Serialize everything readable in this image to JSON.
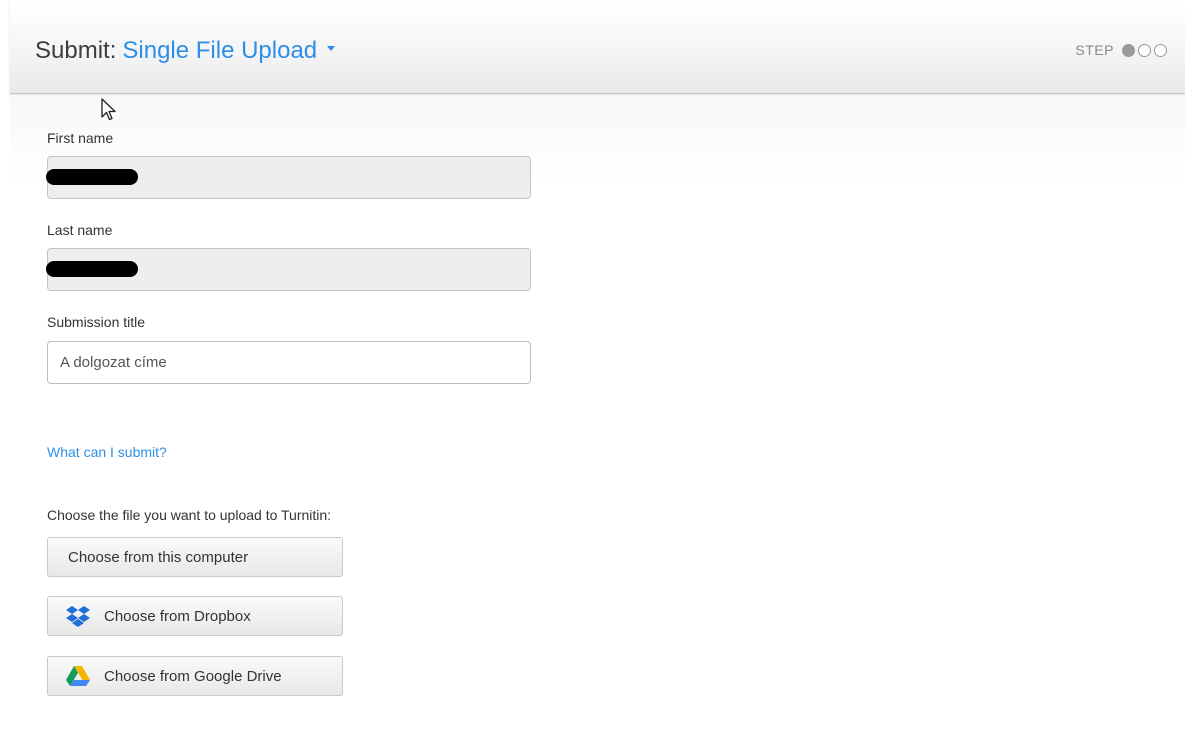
{
  "header": {
    "prefix": "Submit:",
    "mode": "Single File Upload",
    "step_label": "STEP",
    "steps_total": 3,
    "step_current": 1
  },
  "form": {
    "first_name_label": "First name",
    "last_name_label": "Last name",
    "title_label": "Submission title",
    "title_value": "A dolgozat címe"
  },
  "help_link": "What can I submit?",
  "upload": {
    "prompt": "Choose the file you want to upload to Turnitin:",
    "computer_label": "Choose from this computer",
    "dropbox_label": "Choose from Dropbox",
    "gdrive_label": "Choose from Google Drive"
  },
  "colors": {
    "accent": "#2f8ee8",
    "dropbox": "#1f6fd9",
    "gdrive_yellow": "#f4b400",
    "gdrive_green": "#0f9d58",
    "gdrive_blue": "#4285f4"
  }
}
